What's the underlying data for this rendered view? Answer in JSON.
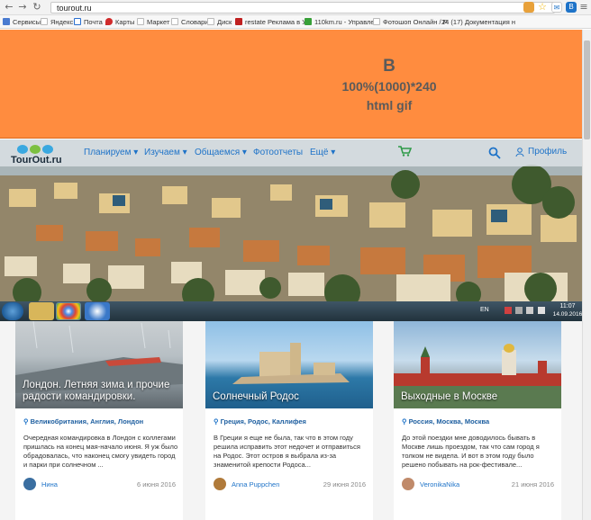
{
  "browser": {
    "url": "tourout.ru",
    "bookmarks": [
      {
        "label": "Сервисы",
        "color": "#4a7bd0"
      },
      {
        "label": "Яндекс",
        "color": "#e0e0e0"
      },
      {
        "label": "Почта",
        "color": "#2a6fd0"
      },
      {
        "label": "Карты",
        "color": "#d02a2a"
      },
      {
        "label": "Маркет",
        "color": "#e0e0e0"
      },
      {
        "label": "Словари",
        "color": "#e0e0e0"
      },
      {
        "label": "Диск",
        "color": "#e0e0e0"
      },
      {
        "label": "restate Реклама в Ут",
        "color": "#c02020"
      },
      {
        "label": "110km.ru - Управлен",
        "color": "#38a038"
      },
      {
        "label": "Фотошоп Онлайн / Р",
        "color": "#e0e0e0"
      },
      {
        "label": "24 (17) Документация н",
        "color": "#1e5fa0"
      }
    ]
  },
  "banner": {
    "line1": "B",
    "line2": "100%(1000)*240",
    "line3": "html gif"
  },
  "site": {
    "logo": "TourOut.ru",
    "nav": [
      "Планируем ▾",
      "Изучаем ▾",
      "Общаемся ▾",
      "Фотоотчеты",
      "Ещё ▾"
    ],
    "profile": "Профиль"
  },
  "taskbar": {
    "lang": "EN",
    "time": "11:07",
    "date": "14.09.2016"
  },
  "cards": [
    {
      "title": "Лондон. Летняя зима и прочие радости командировки.",
      "location": "Великобритания, Англия, Лондон",
      "text": "Очередная командировка в Лондон с коллегами пришлась на конец мая-начало июня. Я уж было обрадовалась, что наконец смогу увидеть город и парки при солнечном ...",
      "author": "Нина",
      "date": "6 июня 2016"
    },
    {
      "title": "Солнечный Родос",
      "location": "Греция, Родос, Каллифея",
      "text": "В Греции я еще не была, так что в этом году решила исправить этот недочет и отправиться на Родос. Этот остров я выбрала из-за знаменитой крепости Родоса...",
      "author": "Anna Puppchen",
      "date": "29 июня 2016"
    },
    {
      "title": "Выходные в Москве",
      "location": "Россия, Москва, Москва",
      "text": "До этой поездки мне доводилось бывать в Москве лишь проездом, так что сам город я толком не видела. И вот в этом году было решено побывать на рок-фестивале...",
      "author": "VeronikaNika",
      "date": "21 июня 2016"
    }
  ]
}
